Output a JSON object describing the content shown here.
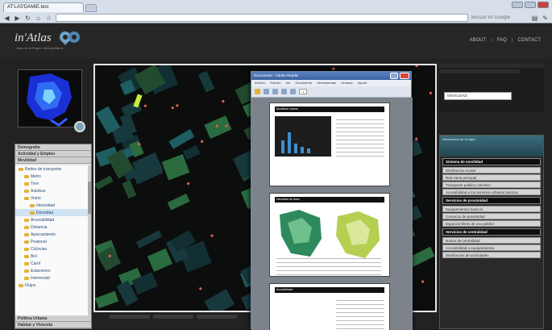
{
  "browser": {
    "tab_title": "AT'LAS'DAMIE.test",
    "url": "",
    "search_hint": "Buscar en Google"
  },
  "site": {
    "logo": "in'Atlas",
    "logo_sub": "Atlas de la Region Metropolitana",
    "nav": [
      "ABOUT",
      "FAQ",
      "CONTACT"
    ]
  },
  "left": {
    "thumb_title": "",
    "thumb_caption": "",
    "accordion": {
      "sections": [
        "Demografia",
        "Actividad y Empleo",
        "Movilidad"
      ],
      "tree": [
        {
          "label": "Redes de transporte",
          "level": 0,
          "selected": false
        },
        {
          "label": "Metro",
          "level": 1,
          "selected": false
        },
        {
          "label": "Tren",
          "level": 1,
          "selected": false
        },
        {
          "label": "Autobus",
          "level": 1,
          "selected": false
        },
        {
          "label": "Viario",
          "level": 1,
          "selected": false
        },
        {
          "label": "Intensidad",
          "level": 2,
          "selected": false
        },
        {
          "label": "Densidad",
          "level": 2,
          "selected": true
        },
        {
          "label": "Accesibilidad",
          "level": 1,
          "selected": false
        },
        {
          "label": "Distancia",
          "level": 1,
          "selected": false
        },
        {
          "label": "Aparcamiento",
          "level": 1,
          "selected": false
        },
        {
          "label": "Peatonal",
          "level": 1,
          "selected": false
        },
        {
          "label": "Ciclovias",
          "level": 1,
          "selected": false
        },
        {
          "label": "Bici",
          "level": 1,
          "selected": false
        },
        {
          "label": "Carril",
          "level": 1,
          "selected": false
        },
        {
          "label": "Estaciones",
          "level": 1,
          "selected": false
        },
        {
          "label": "Intermodal",
          "level": 1,
          "selected": false
        },
        {
          "label": "Flujos",
          "level": 0,
          "selected": false
        }
      ],
      "footer": [
        "Politica Urbana",
        "Habitat y Vivienda"
      ]
    }
  },
  "pdf": {
    "title": "Documento - Adobe Reader",
    "menu": [
      "Archivo",
      "Edicion",
      "Ver",
      "Documento",
      "Herramientas",
      "Ventana",
      "Ayuda"
    ],
    "page_no": "1",
    "page_heads": [
      "Movilidad urbana",
      "Densidad de viario",
      "Accesibilidad"
    ]
  },
  "right": {
    "search_value": "MOVILIDAD",
    "panel_head": "Informacion de la capa",
    "sections": [
      {
        "head": "Sistema de movilidad",
        "items": [
          "Distribucion modal",
          "Red viaria principal",
          "Transporte publico colectivo",
          "Accesibilidad a los servicios urbanos basicos"
        ]
      },
      {
        "head": "Servicios de proximidad",
        "items": [
          "Equipamientos basicos",
          "Comercio de proximidad",
          "Espacios libres de uso publico"
        ]
      },
      {
        "head": "Servicios de centralidad",
        "items": [
          "Nodos de centralidad",
          "Accesibilidad a equipamientos",
          "Distribucion de actividades"
        ]
      }
    ]
  },
  "colors": {
    "accent": "#3c6d7c",
    "map_dark": "#0c0d0d",
    "map_teal": "#1e5d62",
    "map_green": "#2a6b3f"
  }
}
